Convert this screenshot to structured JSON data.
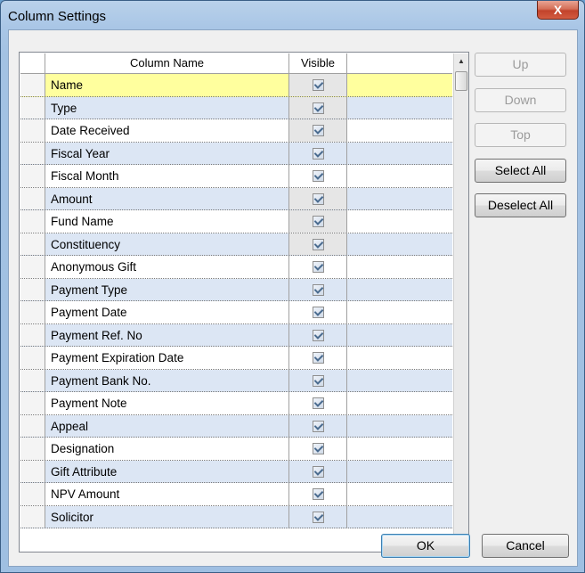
{
  "window": {
    "title": "Column Settings",
    "close_glyph": "X"
  },
  "grid": {
    "headers": {
      "column_name": "Column Name",
      "visible": "Visible"
    },
    "rows": [
      {
        "name": "Name",
        "visible": true,
        "readonly": true
      },
      {
        "name": "Type",
        "visible": true,
        "readonly": true
      },
      {
        "name": "Date Received",
        "visible": true,
        "readonly": true
      },
      {
        "name": "Fiscal Year",
        "visible": true,
        "readonly": false
      },
      {
        "name": "Fiscal Month",
        "visible": true,
        "readonly": false
      },
      {
        "name": "Amount",
        "visible": true,
        "readonly": true
      },
      {
        "name": "Fund Name",
        "visible": true,
        "readonly": true
      },
      {
        "name": "Constituency",
        "visible": true,
        "readonly": true
      },
      {
        "name": "Anonymous Gift",
        "visible": true,
        "readonly": false
      },
      {
        "name": "Payment Type",
        "visible": true,
        "readonly": false
      },
      {
        "name": "Payment Date",
        "visible": true,
        "readonly": false
      },
      {
        "name": "Payment Ref. No",
        "visible": true,
        "readonly": false
      },
      {
        "name": "Payment Expiration Date",
        "visible": true,
        "readonly": false
      },
      {
        "name": "Payment Bank No.",
        "visible": true,
        "readonly": false
      },
      {
        "name": "Payment Note",
        "visible": true,
        "readonly": false
      },
      {
        "name": "Appeal",
        "visible": true,
        "readonly": false
      },
      {
        "name": "Designation",
        "visible": true,
        "readonly": false
      },
      {
        "name": "Gift Attribute",
        "visible": true,
        "readonly": false
      },
      {
        "name": "NPV Amount",
        "visible": true,
        "readonly": false
      },
      {
        "name": "Solicitor",
        "visible": true,
        "readonly": false
      }
    ],
    "selected_index": 0
  },
  "buttons": {
    "up": "Up",
    "down": "Down",
    "top": "Top",
    "select_all": "Select All",
    "deselect_all": "Deselect All",
    "ok": "OK",
    "cancel": "Cancel"
  },
  "scrollbar": {
    "up_glyph": "▲",
    "down_glyph": "▼"
  }
}
